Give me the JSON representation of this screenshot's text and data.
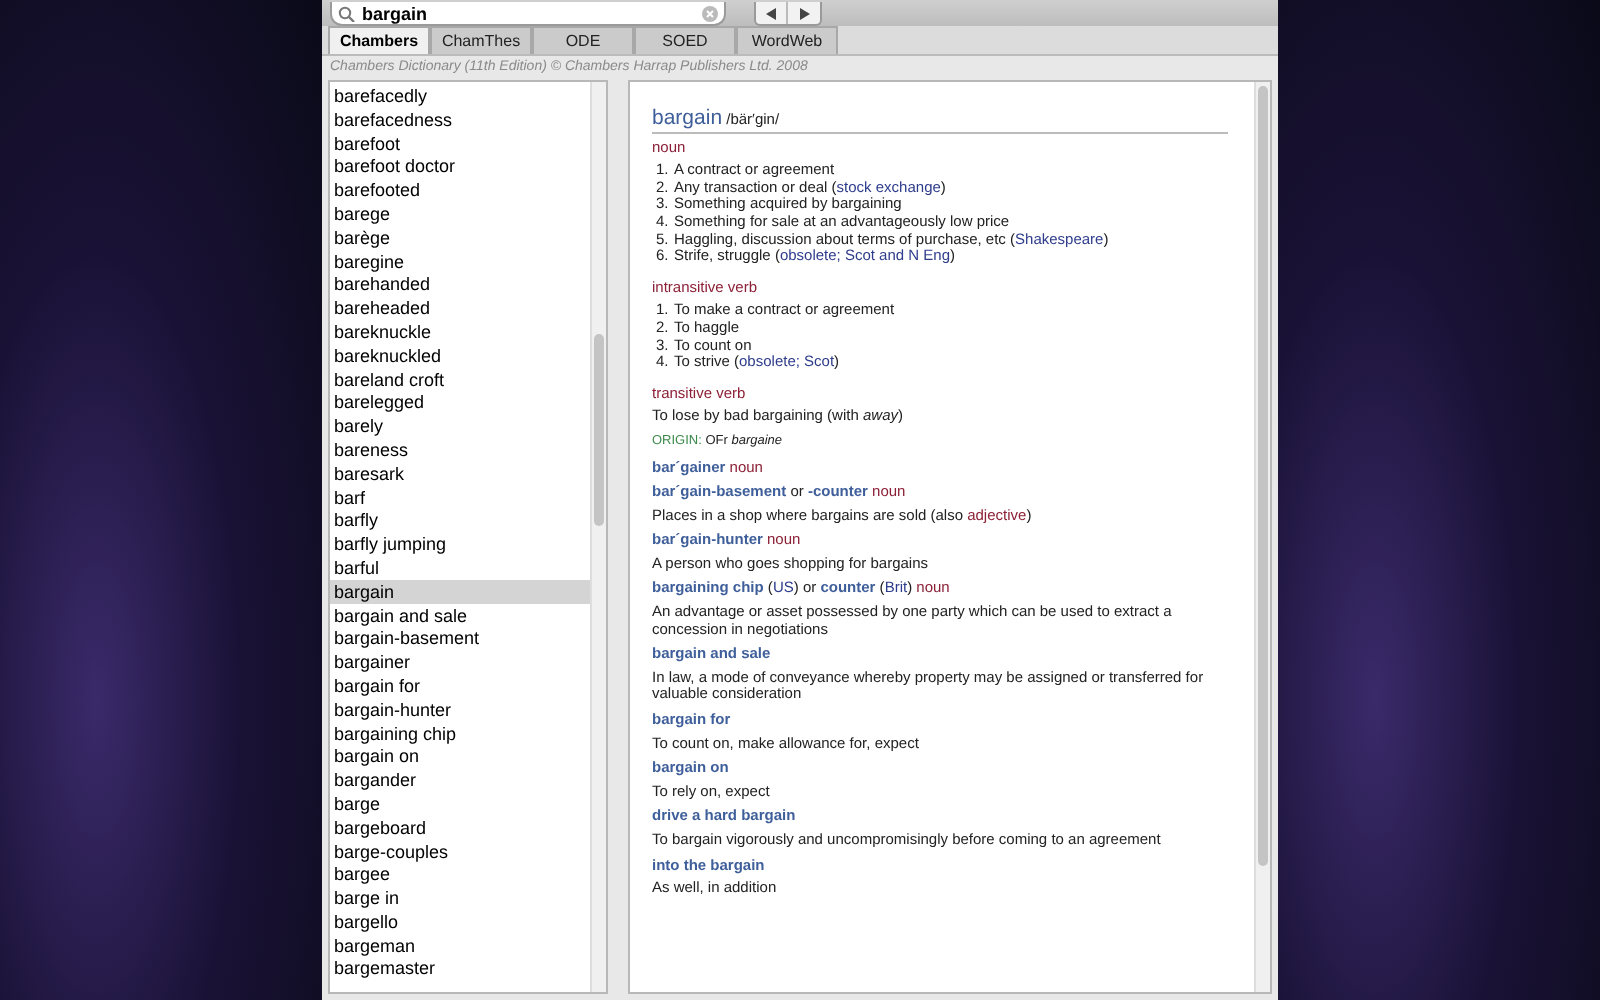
{
  "search": {
    "value": "bargain"
  },
  "tabs": [
    {
      "label": "Chambers",
      "selected": true
    },
    {
      "label": "ChamThes",
      "selected": false
    },
    {
      "label": "ODE",
      "selected": false
    },
    {
      "label": "SOED",
      "selected": false
    },
    {
      "label": "WordWeb",
      "selected": false
    }
  ],
  "copyright": "Chambers Dictionary (11th Edition) © Chambers Harrap Publishers Ltd. 2008",
  "word_list": [
    {
      "label": "barefacedly",
      "selected": false
    },
    {
      "label": "barefacedness",
      "selected": false
    },
    {
      "label": "barefoot",
      "selected": false
    },
    {
      "label": "barefoot doctor",
      "selected": false
    },
    {
      "label": "barefooted",
      "selected": false
    },
    {
      "label": "barege",
      "selected": false
    },
    {
      "label": "barège",
      "selected": false
    },
    {
      "label": "baregine",
      "selected": false
    },
    {
      "label": "barehanded",
      "selected": false
    },
    {
      "label": "bareheaded",
      "selected": false
    },
    {
      "label": "bareknuckle",
      "selected": false
    },
    {
      "label": "bareknuckled",
      "selected": false
    },
    {
      "label": "bareland croft",
      "selected": false
    },
    {
      "label": "barelegged",
      "selected": false
    },
    {
      "label": "barely",
      "selected": false
    },
    {
      "label": "bareness",
      "selected": false
    },
    {
      "label": "baresark",
      "selected": false
    },
    {
      "label": "barf",
      "selected": false
    },
    {
      "label": "barfly",
      "selected": false
    },
    {
      "label": "barfly jumping",
      "selected": false
    },
    {
      "label": "barful",
      "selected": false
    },
    {
      "label": "bargain",
      "selected": true
    },
    {
      "label": "bargain and sale",
      "selected": false
    },
    {
      "label": "bargain-basement",
      "selected": false
    },
    {
      "label": "bargainer",
      "selected": false
    },
    {
      "label": "bargain for",
      "selected": false
    },
    {
      "label": "bargain-hunter",
      "selected": false
    },
    {
      "label": "bargaining chip",
      "selected": false
    },
    {
      "label": "bargain on",
      "selected": false
    },
    {
      "label": "bargander",
      "selected": false
    },
    {
      "label": "barge",
      "selected": false
    },
    {
      "label": "bargeboard",
      "selected": false
    },
    {
      "label": "barge-couples",
      "selected": false
    },
    {
      "label": "bargee",
      "selected": false
    },
    {
      "label": "barge in",
      "selected": false
    },
    {
      "label": "bargello",
      "selected": false
    },
    {
      "label": "bargeman",
      "selected": false
    },
    {
      "label": "bargemaster",
      "selected": false
    }
  ],
  "entry": {
    "headword": "bargain",
    "pronunciation": "/bär′gin/",
    "sections": [
      {
        "pos": "noun",
        "senses": [
          {
            "number": "1.",
            "segments": [
              {
                "kind": "plain",
                "t": "A contract or agreement"
              }
            ]
          },
          {
            "number": "2.",
            "segments": [
              {
                "kind": "plain",
                "t": "Any transaction or deal ("
              },
              {
                "kind": "label",
                "t": "stock exchange"
              },
              {
                "kind": "plain",
                "t": ")"
              }
            ]
          },
          {
            "number": "3.",
            "segments": [
              {
                "kind": "plain",
                "t": "Something acquired by bargaining"
              }
            ]
          },
          {
            "number": "4.",
            "segments": [
              {
                "kind": "plain",
                "t": "Something for sale at an advantageously low price"
              }
            ]
          },
          {
            "number": "5.",
            "segments": [
              {
                "kind": "plain",
                "t": "Haggling, discussion about terms of purchase, etc ("
              },
              {
                "kind": "label",
                "t": "Shakespeare"
              },
              {
                "kind": "plain",
                "t": ")"
              }
            ]
          },
          {
            "number": "6.",
            "segments": [
              {
                "kind": "plain",
                "t": "Strife, struggle ("
              },
              {
                "kind": "label",
                "t": "obsolete; Scot and N Eng"
              },
              {
                "kind": "plain",
                "t": ")"
              }
            ]
          }
        ]
      },
      {
        "pos": "intransitive verb",
        "senses": [
          {
            "number": "1.",
            "segments": [
              {
                "kind": "plain",
                "t": "To make a contract or agreement"
              }
            ]
          },
          {
            "number": "2.",
            "segments": [
              {
                "kind": "plain",
                "t": "To haggle"
              }
            ]
          },
          {
            "number": "3.",
            "segments": [
              {
                "kind": "plain",
                "t": "To count on"
              }
            ]
          },
          {
            "number": "4.",
            "segments": [
              {
                "kind": "plain",
                "t": "To strive ("
              },
              {
                "kind": "label",
                "t": "obsolete; Scot"
              },
              {
                "kind": "plain",
                "t": ")"
              }
            ]
          }
        ]
      },
      {
        "pos": "transitive verb",
        "definition": "To lose by bad bargaining (with *away*)"
      }
    ],
    "origin": [
      {
        "kind": "origin",
        "t": "ORIGIN:"
      },
      {
        "kind": "plain",
        "t": " OFr "
      },
      {
        "kind": "italic",
        "t": "bargaine"
      }
    ],
    "derived": [
      {
        "heads": [
          [
            {
              "kind": "head",
              "t": "bar´gainer"
            },
            {
              "kind": "pos",
              "t": " noun"
            }
          ]
        ]
      },
      {
        "heads": [
          [
            {
              "kind": "head",
              "t": "bar´gain-basement"
            },
            {
              "kind": "plain",
              "t": " or "
            },
            {
              "kind": "head",
              "t": "-counter"
            },
            {
              "kind": "pos",
              "t": " noun"
            }
          ]
        ],
        "definition": [
          {
            "kind": "plain",
            "t": "Places in a shop where bargains are sold (also "
          },
          {
            "kind": "pos",
            "t": "adjective"
          },
          {
            "kind": "plain",
            "t": ")"
          }
        ]
      },
      {
        "heads": [
          [
            {
              "kind": "head",
              "t": "bar´gain-hunter"
            },
            {
              "kind": "pos",
              "t": " noun"
            }
          ]
        ],
        "definition": [
          {
            "kind": "plain",
            "t": "A person who goes shopping for bargains"
          }
        ]
      },
      {
        "heads": [
          [
            {
              "kind": "head",
              "t": "bargaining chip"
            },
            {
              "kind": "plain",
              "t": " ("
            },
            {
              "kind": "label",
              "t": "US"
            },
            {
              "kind": "plain",
              "t": ") or "
            },
            {
              "kind": "head",
              "t": "counter"
            },
            {
              "kind": "plain",
              "t": " ("
            },
            {
              "kind": "label",
              "t": "Brit"
            },
            {
              "kind": "plain",
              "t": ")"
            },
            {
              "kind": "pos",
              "t": " noun"
            }
          ]
        ],
        "definition": [
          {
            "kind": "plain",
            "t": "An advantage or asset possessed by one party which can be used to extract a concession in negotiations"
          }
        ]
      },
      {
        "heads": [
          [
            {
              "kind": "head",
              "t": "bargain and sale"
            }
          ]
        ],
        "definition": [
          {
            "kind": "plain",
            "t": "In law, a mode of conveyance whereby property may be assigned or transferred for valuable consideration"
          }
        ]
      },
      {
        "heads": [
          [
            {
              "kind": "head",
              "t": "bargain for"
            }
          ]
        ],
        "definition": [
          {
            "kind": "plain",
            "t": "To count on, make allowance for, expect"
          }
        ]
      },
      {
        "heads": [
          [
            {
              "kind": "head",
              "t": "bargain on"
            }
          ]
        ],
        "definition": [
          {
            "kind": "plain",
            "t": "To rely on, expect"
          }
        ]
      },
      {
        "heads": [
          [
            {
              "kind": "head",
              "t": "drive a hard bargain"
            }
          ]
        ],
        "definition": [
          {
            "kind": "plain",
            "t": "To bargain vigorously and uncompromisingly before coming to an agreement"
          }
        ]
      },
      {
        "heads": [
          [
            {
              "kind": "head",
              "t": "into the bargain"
            }
          ]
        ],
        "definition": [
          {
            "kind": "plain",
            "t": "As well, in addition"
          }
        ]
      }
    ]
  }
}
